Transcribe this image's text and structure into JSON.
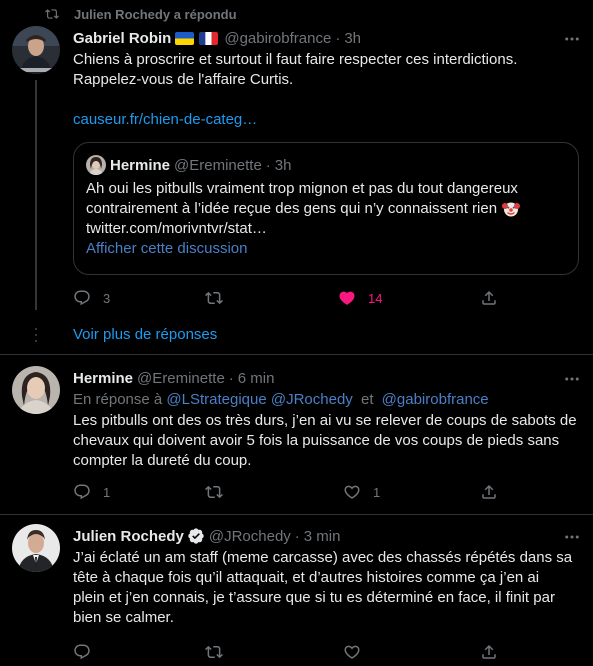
{
  "retweet_context": {
    "text": "Julien Rochedy a répondu"
  },
  "tweet1": {
    "name": "Gabriel Robin",
    "handle": "@gabirobfrance",
    "time": "3h",
    "text_line1": "Chiens à proscrire et surtout il faut faire respecter ces interdictions.",
    "text_line2": "Rappelez-vous de l'affaire Curtis.",
    "link": "causeur.fr/chien-de-categ…",
    "quote": {
      "name": "Hermine",
      "handle": "@Ereminette",
      "time": "3h",
      "line1": "Ah oui les pitbulls vraiment trop mignon et pas du tout dangereux",
      "line2": "contrairement à l’idée reçue des gens qui n’y connaissent rien",
      "line3": "twitter.com/morivntvr/stat…",
      "show_thread": "Afficher cette discussion"
    },
    "replies": "3",
    "likes": "14"
  },
  "show_more": "Voir plus de réponses",
  "tweet2": {
    "name": "Hermine",
    "handle": "@Ereminette",
    "time": "6 min",
    "reply_prefix": "En réponse à",
    "mention1": "@LStrategique",
    "mention2": "@JRochedy",
    "reply_and": "et",
    "mention3": "@gabirobfrance",
    "line1": "Les pitbulls ont des os très durs, j’en ai vu se relever de coups de sabots de",
    "line2": "chevaux qui doivent avoir 5 fois la puissance de vos coups de pieds sans",
    "line3": "compter la dureté du coup.",
    "replies": "1",
    "likes": "1"
  },
  "tweet3": {
    "name": "Julien Rochedy",
    "handle": "@JRochedy",
    "time": "3 min",
    "line1": "J’ai éclaté un am staff (meme carcasse) avec des chassés répétés dans sa",
    "line2": "tête à chaque fois qu’il attaquait, et d’autres histoires comme ça j’en ai",
    "line3": "plein et j’en connais, je t’assure que si tu es déterminé en face, il finit par",
    "line4": "bien se calmer."
  },
  "colors": {
    "accent": "#1d9bf0",
    "like": "#f91880",
    "muted": "#71767b",
    "verified": "#1d9bf0"
  },
  "icons": [
    "retweet-icon",
    "reply-icon",
    "retweet-icon",
    "heart-icon",
    "share-icon",
    "more-icon",
    "verified-icon",
    "clown-emoji-icon",
    "ukraine-flag-icon",
    "france-flag-icon"
  ]
}
